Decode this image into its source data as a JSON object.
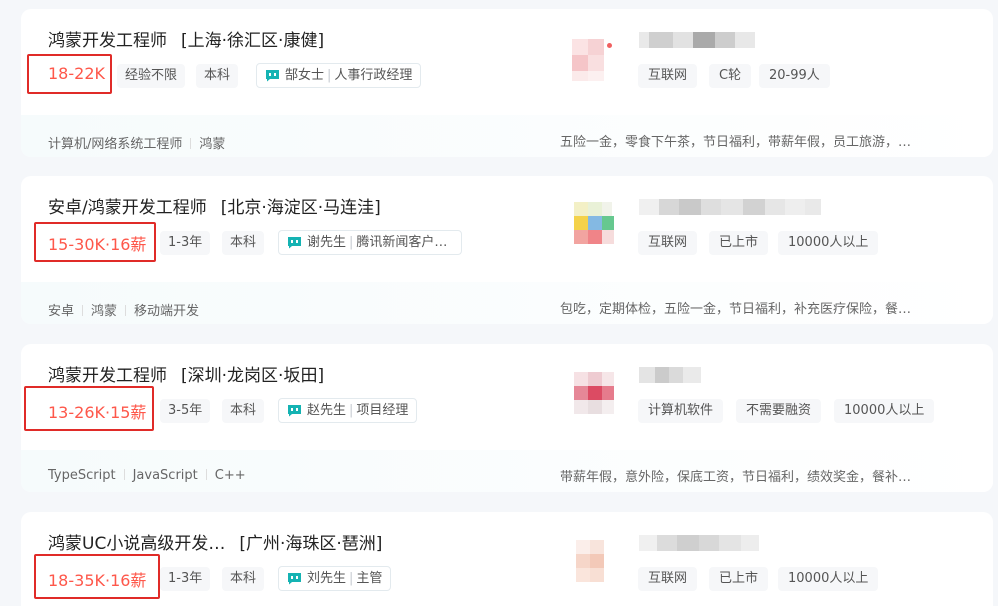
{
  "jobs": [
    {
      "title": "鸿蒙开发工程师",
      "area": "[上海·徐汇区·康健]",
      "salary": "18-22K",
      "tags": [
        "经验不限",
        "本科"
      ],
      "boss_name": "郜女士",
      "boss_title": "人事行政经理",
      "company_tags": [
        "互联网",
        "C轮",
        "20-99人"
      ],
      "skills": [
        "计算机/网络系统工程师",
        "鸿蒙"
      ],
      "welfare": "五险一金，零食下午茶，节日福利，带薪年假，员工旅游，…"
    },
    {
      "title": "安卓/鸿蒙开发工程师",
      "area": "[北京·海淀区·马连洼]",
      "salary": "15-30K·16薪",
      "tags": [
        "1-3年",
        "本科"
      ],
      "boss_name": "谢先生",
      "boss_title": "腾讯新闻客户…",
      "company_tags": [
        "互联网",
        "已上市",
        "10000人以上"
      ],
      "skills": [
        "安卓",
        "鸿蒙",
        "移动端开发"
      ],
      "welfare": "包吃，定期体检，五险一金，节日福利，补充医疗保险，餐…"
    },
    {
      "title": "鸿蒙开发工程师",
      "area": "[深圳·龙岗区·坂田]",
      "salary": "13-26K·15薪",
      "tags": [
        "3-5年",
        "本科"
      ],
      "boss_name": "赵先生",
      "boss_title": "项目经理",
      "company_tags": [
        "计算机软件",
        "不需要融资",
        "10000人以上"
      ],
      "skills": [
        "TypeScript",
        "JavaScript",
        "C++"
      ],
      "welfare": "带薪年假，意外险，保底工资，节日福利，绩效奖金，餐补…"
    },
    {
      "title": "鸿蒙UC小说高级开发…",
      "area": "[广州·海珠区·琶洲]",
      "salary": "18-35K·16薪",
      "tags": [
        "1-3年",
        "本科"
      ],
      "boss_name": "刘先生",
      "boss_title": "主管",
      "company_tags": [
        "互联网",
        "已上市",
        "10000人以上"
      ]
    }
  ],
  "colors": {
    "salary": "#fe574a",
    "highlight_box": "#e02b28",
    "chat_icon": "#15b3b3"
  },
  "icons": {
    "chat": "chat-bubble-icon"
  }
}
